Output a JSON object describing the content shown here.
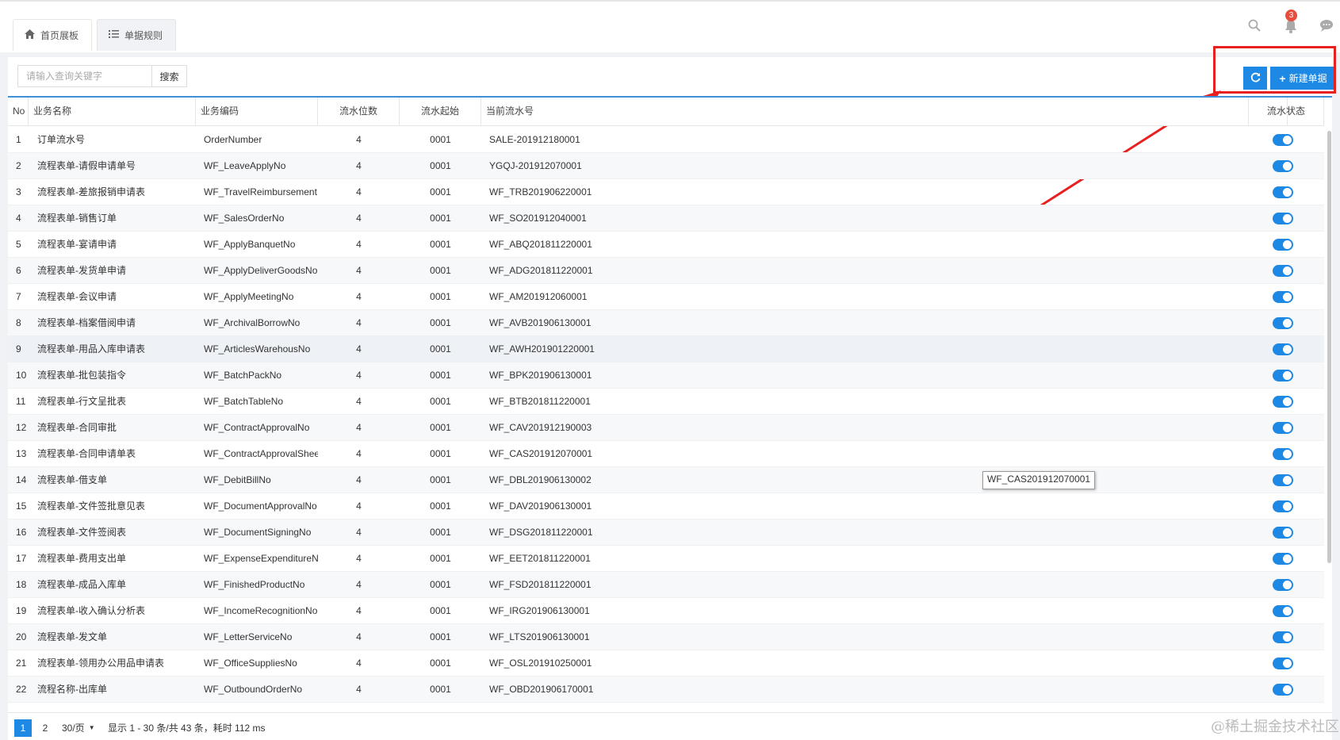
{
  "tabs": [
    {
      "label": "首页展板",
      "icon": "home-icon"
    },
    {
      "label": "单据规则",
      "icon": "list-icon"
    }
  ],
  "notifications": {
    "count": "3"
  },
  "toolbar": {
    "search_placeholder": "请输入查询关键字",
    "search_label": "搜索",
    "new_label": "新建单据"
  },
  "columns": [
    "No",
    "业务名称",
    "业务编码",
    "流水位数",
    "流水起始",
    "当前流水号",
    "流水状态"
  ],
  "rows": [
    {
      "no": "1",
      "name": "订单流水号",
      "code": "OrderNumber",
      "digits": "4",
      "start": "0001",
      "current": "SALE-201912180001",
      "enabled": true
    },
    {
      "no": "2",
      "name": "流程表单-请假申请单号",
      "code": "WF_LeaveApplyNo",
      "digits": "4",
      "start": "0001",
      "current": "YGQJ-201912070001",
      "enabled": true
    },
    {
      "no": "3",
      "name": "流程表单-差旅报销申请表",
      "code": "WF_TravelReimbursement",
      "digits": "4",
      "start": "0001",
      "current": "WF_TRB201906220001",
      "enabled": true
    },
    {
      "no": "4",
      "name": "流程表单-销售订单",
      "code": "WF_SalesOrderNo",
      "digits": "4",
      "start": "0001",
      "current": "WF_SO201912040001",
      "enabled": true
    },
    {
      "no": "5",
      "name": "流程表单-宴请申请",
      "code": "WF_ApplyBanquetNo",
      "digits": "4",
      "start": "0001",
      "current": "WF_ABQ201811220001",
      "enabled": true
    },
    {
      "no": "6",
      "name": "流程表单-发货单申请",
      "code": "WF_ApplyDeliverGoodsNo",
      "digits": "4",
      "start": "0001",
      "current": "WF_ADG201811220001",
      "enabled": true
    },
    {
      "no": "7",
      "name": "流程表单-会议申请",
      "code": "WF_ApplyMeetingNo",
      "digits": "4",
      "start": "0001",
      "current": "WF_AM201912060001",
      "enabled": true
    },
    {
      "no": "8",
      "name": "流程表单-档案借阅申请",
      "code": "WF_ArchivalBorrowNo",
      "digits": "4",
      "start": "0001",
      "current": "WF_AVB201906130001",
      "enabled": true
    },
    {
      "no": "9",
      "name": "流程表单-用品入库申请表",
      "code": "WF_ArticlesWarehousNo",
      "digits": "4",
      "start": "0001",
      "current": "WF_AWH201901220001",
      "enabled": true
    },
    {
      "no": "10",
      "name": "流程表单-批包装指令",
      "code": "WF_BatchPackNo",
      "digits": "4",
      "start": "0001",
      "current": "WF_BPK201906130001",
      "enabled": true
    },
    {
      "no": "11",
      "name": "流程表单-行文呈批表",
      "code": "WF_BatchTableNo",
      "digits": "4",
      "start": "0001",
      "current": "WF_BTB201811220001",
      "enabled": true
    },
    {
      "no": "12",
      "name": "流程表单-合同审批",
      "code": "WF_ContractApprovalNo",
      "digits": "4",
      "start": "0001",
      "current": "WF_CAV201912190003",
      "enabled": true
    },
    {
      "no": "13",
      "name": "流程表单-合同申请单表",
      "code": "WF_ContractApprovalSheet",
      "digits": "4",
      "start": "0001",
      "current": "WF_CAS201912070001",
      "enabled": true
    },
    {
      "no": "14",
      "name": "流程表单-借支单",
      "code": "WF_DebitBillNo",
      "digits": "4",
      "start": "0001",
      "current": "WF_DBL201906130002",
      "enabled": true
    },
    {
      "no": "15",
      "name": "流程表单-文件签批意见表",
      "code": "WF_DocumentApprovalNo",
      "digits": "4",
      "start": "0001",
      "current": "WF_DAV201906130001",
      "enabled": true
    },
    {
      "no": "16",
      "name": "流程表单-文件签阅表",
      "code": "WF_DocumentSigningNo",
      "digits": "4",
      "start": "0001",
      "current": "WF_DSG201811220001",
      "enabled": true
    },
    {
      "no": "17",
      "name": "流程表单-费用支出单",
      "code": "WF_ExpenseExpenditureNo",
      "digits": "4",
      "start": "0001",
      "current": "WF_EET201811220001",
      "enabled": true
    },
    {
      "no": "18",
      "name": "流程表单-成品入库单",
      "code": "WF_FinishedProductNo",
      "digits": "4",
      "start": "0001",
      "current": "WF_FSD201811220001",
      "enabled": true
    },
    {
      "no": "19",
      "name": "流程表单-收入确认分析表",
      "code": "WF_IncomeRecognitionNo",
      "digits": "4",
      "start": "0001",
      "current": "WF_IRG201906130001",
      "enabled": true
    },
    {
      "no": "20",
      "name": "流程表单-发文单",
      "code": "WF_LetterServiceNo",
      "digits": "4",
      "start": "0001",
      "current": "WF_LTS201906130001",
      "enabled": true
    },
    {
      "no": "21",
      "name": "流程表单-领用办公用品申请表",
      "code": "WF_OfficeSuppliesNo",
      "digits": "4",
      "start": "0001",
      "current": "WF_OSL201910250001",
      "enabled": true
    },
    {
      "no": "22",
      "name": "流程名称-出库单",
      "code": "WF_OutboundOrderNo",
      "digits": "4",
      "start": "0001",
      "current": "WF_OBD201906170001",
      "enabled": true
    }
  ],
  "tooltip": "WF_CAS201912070001",
  "pagination": {
    "pages": [
      "1",
      "2"
    ],
    "page_size": "30/页",
    "summary": "显示 1 - 30 条/共 43 条，耗时 112 ms"
  },
  "watermark": "@稀土掘金技术社区",
  "colors": {
    "accent": "#1e88e5",
    "highlight": "#e82020"
  }
}
